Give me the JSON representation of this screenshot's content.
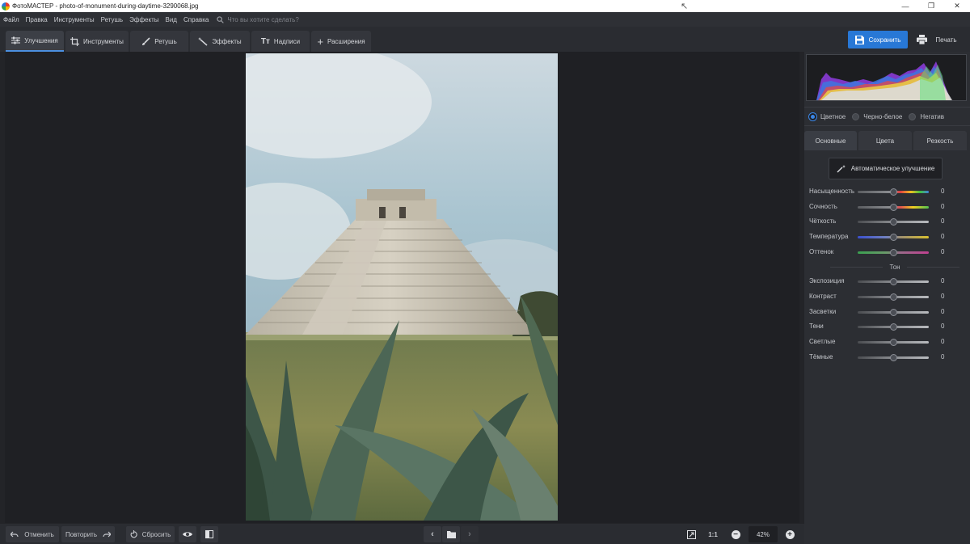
{
  "window": {
    "title": "ФотоМАСТЕР - photo-of-monument-during-daytime-3290068.jpg",
    "controls": [
      "—",
      "❐",
      "✕"
    ]
  },
  "menu": {
    "items": [
      "Файл",
      "Правка",
      "Инструменты",
      "Ретушь",
      "Эффекты",
      "Вид",
      "Справка"
    ],
    "search_placeholder": "Что вы хотите сделать?"
  },
  "toolbar": {
    "tabs": [
      {
        "label": "Улучшения",
        "icon": "sliders-icon",
        "active": true
      },
      {
        "label": "Инструменты",
        "icon": "crop-icon",
        "active": false
      },
      {
        "label": "Ретушь",
        "icon": "brush-icon",
        "active": false
      },
      {
        "label": "Эффекты",
        "icon": "magic-wand-icon",
        "active": false
      },
      {
        "label": "Надписи",
        "icon": "text-icon",
        "active": false
      },
      {
        "label": "Расширения",
        "icon": "plus-icon",
        "active": false
      }
    ],
    "save_label": "Сохранить",
    "print_label": "Печать",
    "accent_color": "#2878d6"
  },
  "bottombar": {
    "undo_label": "Отменить",
    "redo_label": "Повторить",
    "reset_label": "Сбросить",
    "one_to_one_label": "1:1",
    "zoom": "42%"
  },
  "panel": {
    "modes": [
      {
        "label": "Цветное",
        "selected": true
      },
      {
        "label": "Черно-белое",
        "selected": false
      },
      {
        "label": "Негатив",
        "selected": false
      }
    ],
    "tabs": [
      {
        "label": "Основные",
        "active": true
      },
      {
        "label": "Цвета",
        "active": false
      },
      {
        "label": "Резкость",
        "active": false
      }
    ],
    "auto_label": "Автоматическое улучшение",
    "basic_sliders": [
      {
        "label": "Насыщенность",
        "value": "0",
        "track": "saturation"
      },
      {
        "label": "Сочность",
        "value": "0",
        "track": "vibrance"
      },
      {
        "label": "Чёткость",
        "value": "0",
        "track": "gray"
      },
      {
        "label": "Температура",
        "value": "0",
        "track": "temperature"
      },
      {
        "label": "Оттенок",
        "value": "0",
        "track": "tint"
      }
    ],
    "tone_title": "Тон",
    "tone_sliders": [
      {
        "label": "Экспозиция",
        "value": "0",
        "track": "gray"
      },
      {
        "label": "Контраст",
        "value": "0",
        "track": "gray"
      },
      {
        "label": "Засветки",
        "value": "0",
        "track": "gray"
      },
      {
        "label": "Тени",
        "value": "0",
        "track": "gray"
      },
      {
        "label": "Светлые",
        "value": "0",
        "track": "gray"
      },
      {
        "label": "Тёмные",
        "value": "0",
        "track": "gray"
      }
    ]
  }
}
